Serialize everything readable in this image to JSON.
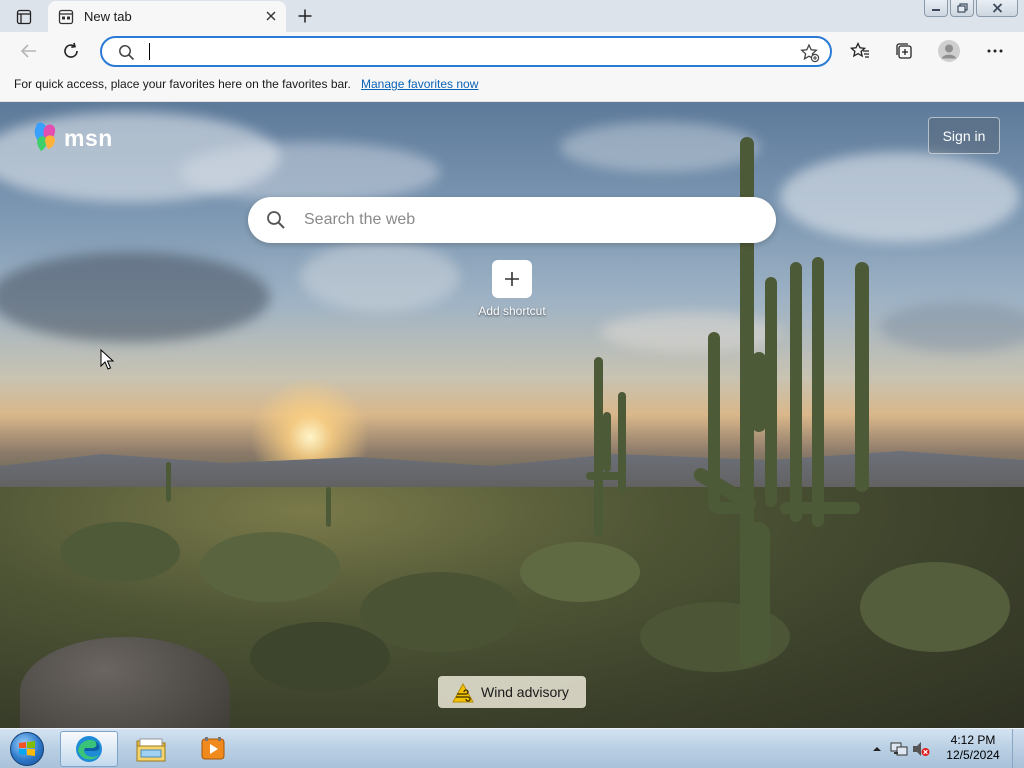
{
  "browser": {
    "tab": {
      "title": "New tab"
    },
    "address_bar": {
      "value": "",
      "placeholder": ""
    },
    "favorites_bar": {
      "message": "For quick access, place your favorites here on the favorites bar.",
      "link": "Manage favorites now"
    }
  },
  "page": {
    "brand": "msn",
    "sign_in": "Sign in",
    "search": {
      "placeholder": "Search the web"
    },
    "shortcut": {
      "label": "Add shortcut"
    },
    "weather_alert": "Wind advisory"
  },
  "taskbar": {
    "apps": [
      "start-orb",
      "edge-icon",
      "file-explorer-icon",
      "media-player-icon"
    ],
    "clock": {
      "time": "4:12 PM",
      "date": "12/5/2024"
    }
  },
  "colors": {
    "accent": "#2b7bd6",
    "link": "#0b63b6",
    "taskbar": "#b9cfe3"
  }
}
